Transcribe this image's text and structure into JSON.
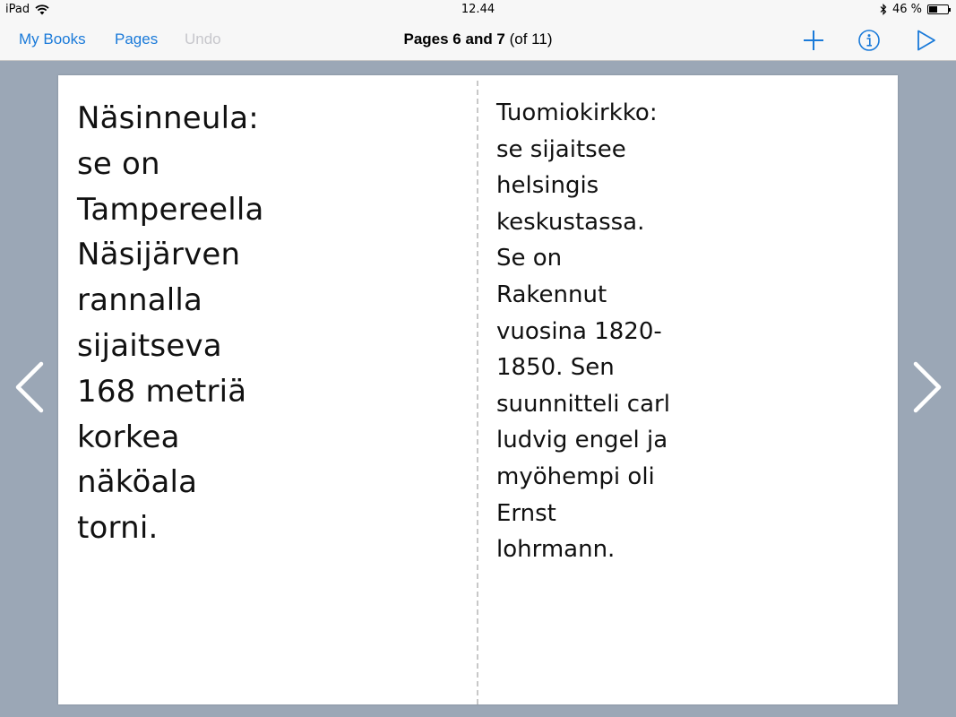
{
  "status": {
    "device": "iPad",
    "time": "12.44",
    "battery": "46 %",
    "battery_level": 0.46
  },
  "toolbar": {
    "my_books": "My Books",
    "pages": "Pages",
    "undo": "Undo",
    "title_bold": "Pages 6 and 7",
    "title_rest": " (of 11)",
    "accent": "#1a7ad9"
  },
  "book": {
    "left_page": "Näsinneula:\nse on\nTampereella\nNäsijärven\nrannalla\nsijaitseva\n168 metriä\nkorkea\nnäköala\ntorni.",
    "right_page": "Tuomiokirkko:\nse sijaitsee\nhelsingis\nkeskustassa.\nSe on\nRakennut\nvuosina 1820-\n1850. Sen\nsuunnitteli carl\nludvig engel ja\nmyöhempi oli\nErnst\nlohrmann."
  },
  "icons": {
    "add": "plus-icon",
    "info": "info-icon",
    "play": "play-icon",
    "prev": "chevron-left-icon",
    "next": "chevron-right-icon"
  }
}
